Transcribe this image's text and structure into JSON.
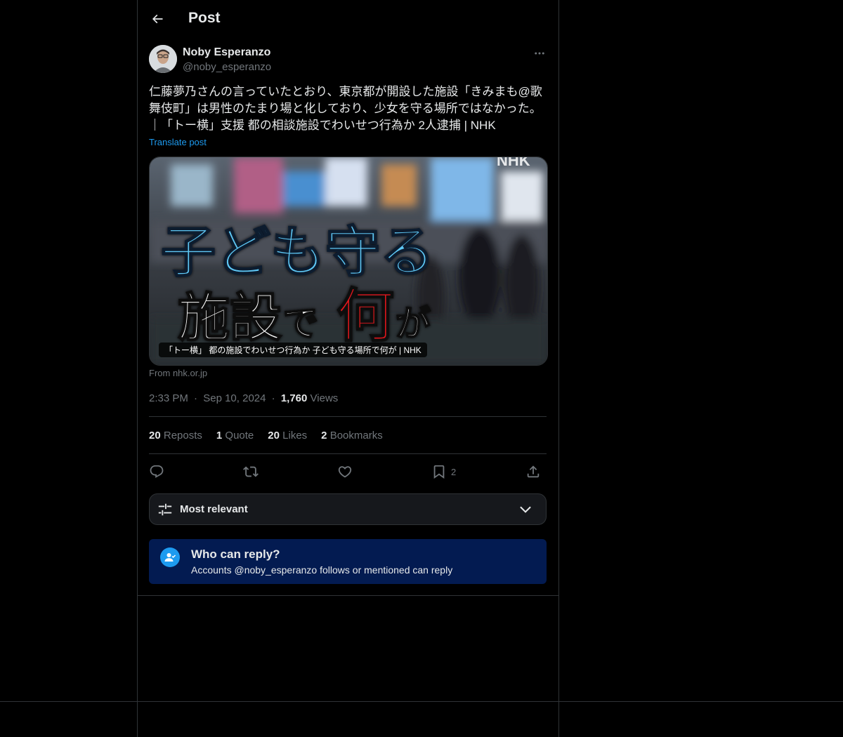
{
  "header": {
    "title": "Post"
  },
  "author": {
    "name": "Noby Esperanzo",
    "handle": "@noby_esperanzo"
  },
  "post": {
    "text_line1": "仁藤夢乃さんの言っていたとおり、東京都が開設した施設「きみまも@歌",
    "text_line2": "舞伎町」は男性のたまり場と化しており、少女を守る場所ではなかった。",
    "text_line3": "｜「トー横」支援 都の相談施設でわいせつ行為か 2人逮捕 | NHK",
    "translate_label": "Translate post"
  },
  "card": {
    "overlay_line1": "子ども守る",
    "overlay_line2a": "施設",
    "overlay_line2b": "で",
    "overlay_line2c": "何",
    "overlay_line2d": "が",
    "watermark": "NHK",
    "caption": "「トー横」 都の施設でわいせつ行為か 子ども守る場所で何が | NHK",
    "source": "From nhk.or.jp"
  },
  "meta": {
    "time": "2:33 PM",
    "dot": "·",
    "date": "Sep 10, 2024",
    "views_count": "1,760",
    "views_label": "Views"
  },
  "stats": {
    "reposts_count": "20",
    "reposts_label": "Reposts",
    "quote_count": "1",
    "quote_label": "Quote",
    "likes_count": "20",
    "likes_label": "Likes",
    "bookmarks_count": "2",
    "bookmarks_label": "Bookmarks"
  },
  "actions": {
    "bookmark_count": "2"
  },
  "sort": {
    "label": "Most relevant"
  },
  "reply": {
    "title": "Who can reply?",
    "subtitle": "Accounts @noby_esperanzo follows or mentioned can reply"
  },
  "colors": {
    "background": "#000000",
    "text": "#e7e9ea",
    "muted": "#71767b",
    "accent": "#1d9bf0",
    "border": "#2f3336",
    "reply_bg": "#031b51",
    "overlay_blue": "#5ec8f5",
    "overlay_red": "#e0151b"
  }
}
